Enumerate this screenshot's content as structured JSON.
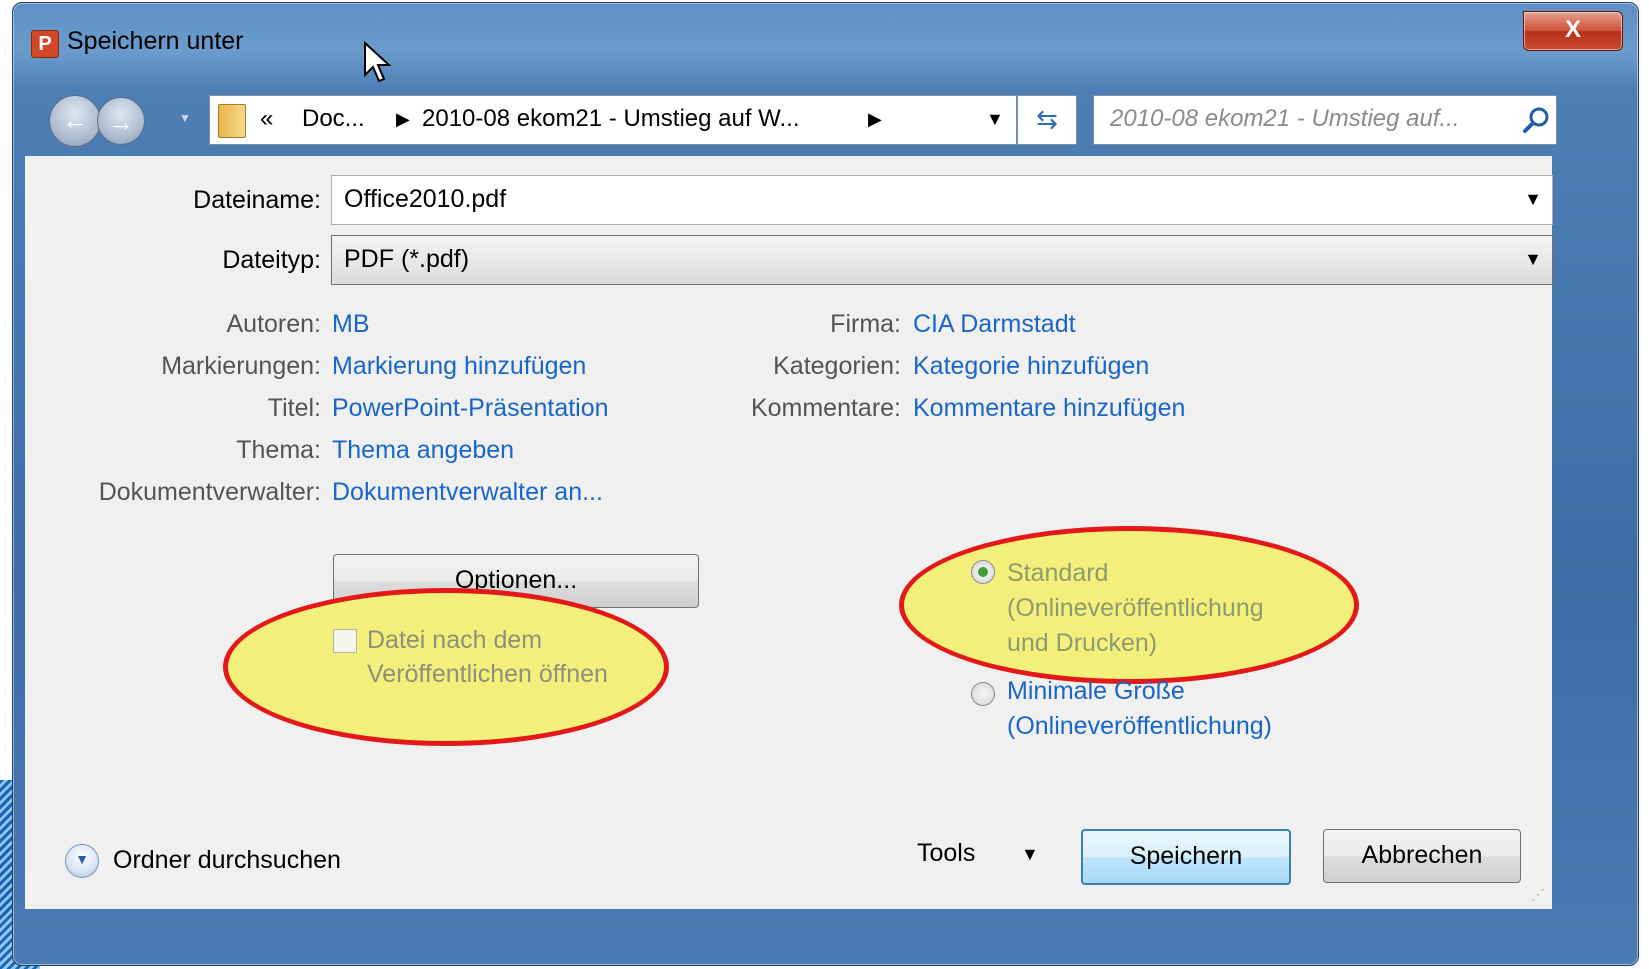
{
  "window": {
    "title": "Speichern unter",
    "app_icon_letter": "P",
    "close_symbol": "X"
  },
  "nav": {
    "address_more": "«",
    "address_crumbs": [
      "Doc...",
      "2010-08 ekom21 - Umstieg auf W..."
    ],
    "search_placeholder": "2010-08 ekom21 - Umstieg auf...",
    "icons": [
      "back-arrow-icon",
      "forward-arrow-icon",
      "folder-icon",
      "refresh-icon",
      "search-icon"
    ]
  },
  "form": {
    "filename_label": "Dateiname:",
    "filename_value": "Office2010.pdf",
    "filetype_label": "Dateityp:",
    "filetype_value": "PDF (*.pdf)"
  },
  "metadata": {
    "left": [
      {
        "label": "Autoren:",
        "value": "MB"
      },
      {
        "label": "Markierungen:",
        "value": "Markierung hinzufügen"
      },
      {
        "label": "Titel:",
        "value": "PowerPoint-Präsentation"
      },
      {
        "label": "Thema:",
        "value": "Thema angeben"
      },
      {
        "label": "Dokumentverwalter:",
        "value": "Dokumentverwalter an..."
      }
    ],
    "right": [
      {
        "label": "Firma:",
        "value": "CIA Darmstadt"
      },
      {
        "label": "Kategorien:",
        "value": "Kategorie hinzufügen"
      },
      {
        "label": "Kommentare:",
        "value": "Kommentare hinzufügen"
      }
    ]
  },
  "options": {
    "options_button": "Optionen...",
    "open_after_publish": "Datei nach dem Veröffentlichen öffnen",
    "open_after_publish_checked": false,
    "optimize_standard": "Standard (Onlineveröffentlichung und Drucken)",
    "optimize_minimal": "Minimale Größe (Onlineveröffentlichung)",
    "selected_optimization": "standard"
  },
  "footer": {
    "browse_folders": "Ordner durchsuchen",
    "tools": "Tools",
    "save": "Speichern",
    "cancel": "Abbrechen"
  },
  "colors": {
    "highlight_fill": "#f2f07a",
    "highlight_border": "#e41818",
    "link_blue": "#1866cc"
  }
}
